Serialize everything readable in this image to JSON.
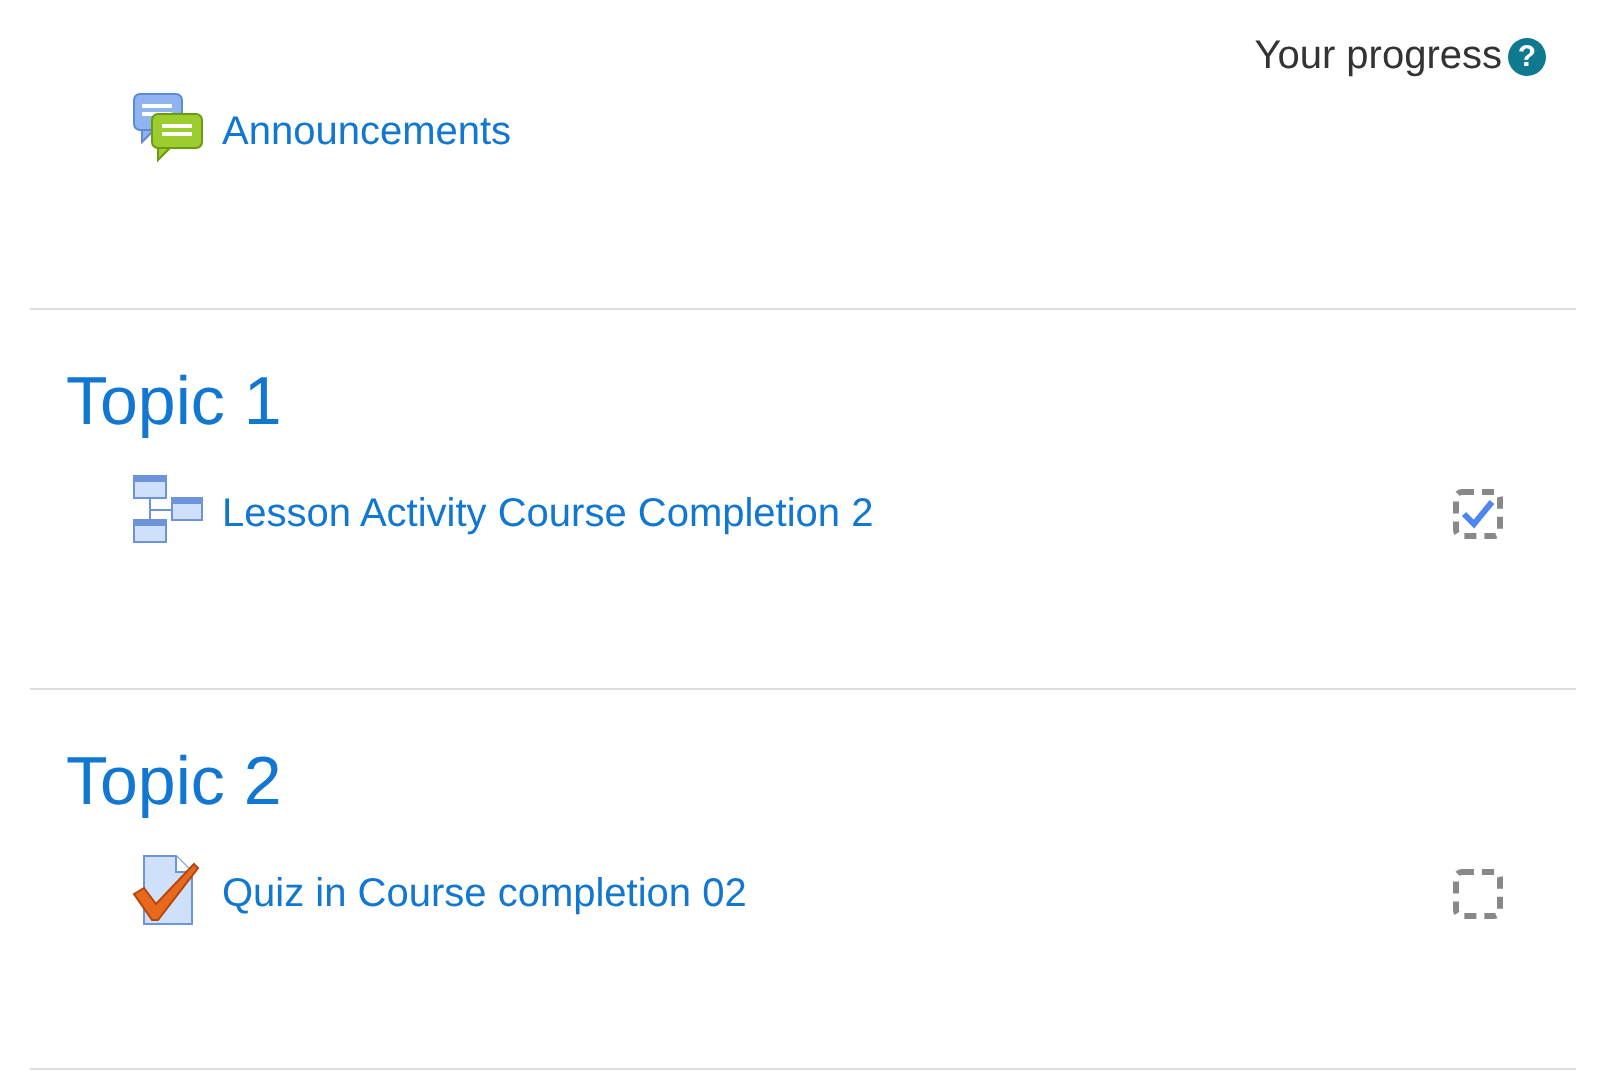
{
  "progress": {
    "label": "Your progress",
    "help_icon": "?"
  },
  "sections": [
    {
      "activities": [
        {
          "kind": "forum",
          "name": "Announcements"
        }
      ]
    },
    {
      "title": "Topic 1",
      "activities": [
        {
          "kind": "lesson",
          "name": "Lesson Activity Course Completion 2",
          "checked": true
        }
      ]
    },
    {
      "title": "Topic 2",
      "activities": [
        {
          "kind": "quiz",
          "name": "Quiz in Course completion 02",
          "checked": false
        }
      ]
    }
  ]
}
